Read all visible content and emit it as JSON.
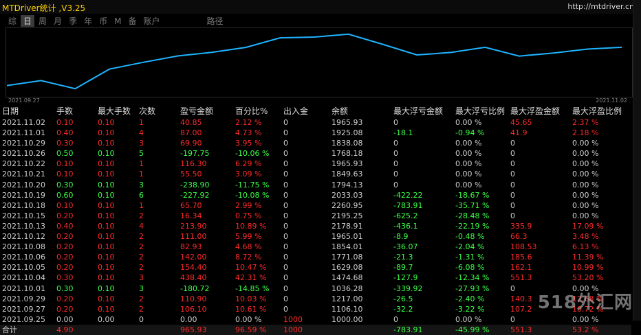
{
  "app": {
    "title": "MTDriver统计 ,V3.25",
    "url": "http://mtdriver.cn"
  },
  "tabs": [
    {
      "label": "综",
      "active": false
    },
    {
      "label": "日",
      "active": true
    },
    {
      "label": "周",
      "active": false
    },
    {
      "label": "月",
      "active": false
    },
    {
      "label": "季",
      "active": false
    },
    {
      "label": "年",
      "active": false
    },
    {
      "label": "币",
      "active": false
    },
    {
      "label": "M",
      "active": false
    },
    {
      "label": "备",
      "active": false
    },
    {
      "label": "账户",
      "active": false
    },
    {
      "label": "路径",
      "active": false
    }
  ],
  "chart": {
    "start_label": "2021.09.27",
    "end_label": "2021.11.02",
    "color": "#1eb4ff"
  },
  "chart_data": {
    "type": "line",
    "x": [
      "2021.09.27",
      "2021.09.29",
      "2021.10.01",
      "2021.10.04",
      "2021.10.05",
      "2021.10.06",
      "2021.10.08",
      "2021.10.12",
      "2021.10.13",
      "2021.10.15",
      "2021.10.18",
      "2021.10.19",
      "2021.10.20",
      "2021.10.21",
      "2021.10.22",
      "2021.10.26",
      "2021.10.29",
      "2021.11.01",
      "2021.11.02"
    ],
    "series": [
      {
        "values": [
          1106.1,
          1217.0,
          1036.28,
          1474.68,
          1629.08,
          1771.08,
          1854.01,
          1965.01,
          2178.91,
          2195.25,
          2260.95,
          2033.03,
          1794.13,
          1849.63,
          1965.93,
          1768.18,
          1838.08,
          1925.08,
          1965.93
        ]
      }
    ],
    "ylim": [
      900,
      2350
    ],
    "grid": false
  },
  "table": {
    "headers": [
      "日期",
      "手数",
      "最大手数",
      "次数",
      "盈亏金额",
      "百分比%",
      "出入金",
      "余额",
      "最大浮亏金额",
      "最大浮亏比例",
      "最大浮盈金额",
      "最大浮盈比例"
    ],
    "rows": [
      [
        "2021.11.02",
        "0.10",
        "0.10",
        "1",
        "40.85",
        "2.12 %",
        "0",
        "1965.93",
        "0",
        "0.00 %",
        "45.65",
        "2.37 %"
      ],
      [
        "2021.11.01",
        "0.40",
        "0.10",
        "4",
        "87.00",
        "4.73 %",
        "0",
        "1925.08",
        "-18.1",
        "-0.94 %",
        "41.9",
        "2.18 %"
      ],
      [
        "2021.10.29",
        "0.30",
        "0.10",
        "3",
        "69.90",
        "3.95 %",
        "0",
        "1838.08",
        "0",
        "0.00 %",
        "0",
        "0.00 %"
      ],
      [
        "2021.10.26",
        "0.50",
        "0.10",
        "5",
        "-197.75",
        "-10.06 %",
        "0",
        "1768.18",
        "0",
        "0.00 %",
        "0",
        "0.00 %"
      ],
      [
        "2021.10.22",
        "0.10",
        "0.10",
        "1",
        "116.30",
        "6.29 %",
        "0",
        "1965.93",
        "0",
        "0.00 %",
        "0",
        "0.00 %"
      ],
      [
        "2021.10.21",
        "0.10",
        "0.10",
        "1",
        "55.50",
        "3.09 %",
        "0",
        "1849.63",
        "0",
        "0.00 %",
        "0",
        "0.00 %"
      ],
      [
        "2021.10.20",
        "0.30",
        "0.10",
        "3",
        "-238.90",
        "-11.75 %",
        "0",
        "1794.13",
        "0",
        "0.00 %",
        "0",
        "0.00 %"
      ],
      [
        "2021.10.19",
        "0.60",
        "0.10",
        "6",
        "-227.92",
        "-10.08 %",
        "0",
        "2033.03",
        "-422.22",
        "-18.67 %",
        "0",
        "0.00 %"
      ],
      [
        "2021.10.18",
        "0.10",
        "0.10",
        "1",
        "65.70",
        "2.99 %",
        "0",
        "2260.95",
        "-783.91",
        "-35.71 %",
        "0",
        "0.00 %"
      ],
      [
        "2021.10.15",
        "0.20",
        "0.10",
        "2",
        "16.34",
        "0.75 %",
        "0",
        "2195.25",
        "-625.2",
        "-28.48 %",
        "0",
        "0.00 %"
      ],
      [
        "2021.10.13",
        "0.40",
        "0.10",
        "4",
        "213.90",
        "10.89 %",
        "0",
        "2178.91",
        "-436.1",
        "-22.19 %",
        "335.9",
        "17.09 %"
      ],
      [
        "2021.10.12",
        "0.20",
        "0.10",
        "2",
        "111.00",
        "5.99 %",
        "0",
        "1965.01",
        "-8.9",
        "-0.48 %",
        "66.3",
        "3.48 %"
      ],
      [
        "2021.10.08",
        "0.20",
        "0.10",
        "2",
        "82.93",
        "4.68 %",
        "0",
        "1854.01",
        "-36.07",
        "-2.04 %",
        "108.53",
        "6.13 %"
      ],
      [
        "2021.10.06",
        "0.20",
        "0.10",
        "2",
        "142.00",
        "8.72 %",
        "0",
        "1771.08",
        "-21.3",
        "-1.31 %",
        "185.6",
        "11.39 %"
      ],
      [
        "2021.10.05",
        "0.20",
        "0.10",
        "2",
        "154.40",
        "10.47 %",
        "0",
        "1629.08",
        "-89.7",
        "-6.08 %",
        "162.1",
        "10.99 %"
      ],
      [
        "2021.10.04",
        "0.30",
        "0.10",
        "3",
        "438.40",
        "42.31 %",
        "0",
        "1474.68",
        "-127.9",
        "-12.34 %",
        "551.3",
        "53.20 %"
      ],
      [
        "2021.10.01",
        "0.30",
        "0.10",
        "3",
        "-180.72",
        "-14.85 %",
        "0",
        "1036.28",
        "-339.92",
        "-27.93 %",
        "0",
        "0.00 %"
      ],
      [
        "2021.09.29",
        "0.20",
        "0.10",
        "2",
        "110.90",
        "10.03 %",
        "0",
        "1217.00",
        "-26.5",
        "-2.40 %",
        "140.3",
        "12.68 %"
      ],
      [
        "2021.09.27",
        "0.20",
        "0.10",
        "2",
        "106.10",
        "10.61 %",
        "0",
        "1106.10",
        "-32.2",
        "-3.22 %",
        "107.2",
        "10.72 %"
      ],
      [
        "2021.09.25",
        "0.00",
        "0.00",
        "0",
        "0.00",
        "0.00 %",
        "1000",
        "1000.00",
        "0",
        "0.00 %",
        "0",
        "0.00 %"
      ]
    ],
    "total": [
      "合计",
      "4.90",
      "",
      "",
      "965.93",
      "96.59 %",
      "1000",
      "",
      "-783.91",
      "-45.99 %",
      "551.3",
      "53.2 %"
    ]
  },
  "watermark": "518外汇网"
}
